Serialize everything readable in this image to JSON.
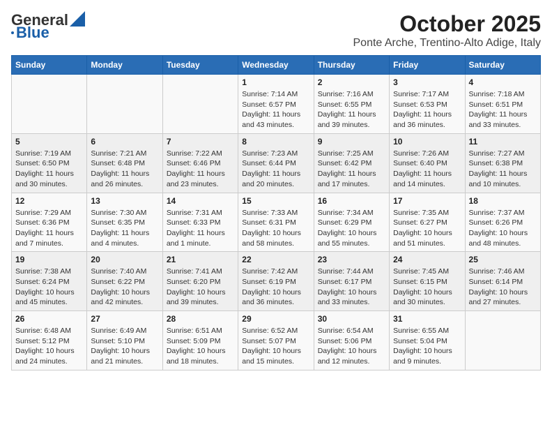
{
  "header": {
    "logo_line1": "General",
    "logo_line2": "Blue",
    "title": "October 2025",
    "subtitle": "Ponte Arche, Trentino-Alto Adige, Italy"
  },
  "weekdays": [
    "Sunday",
    "Monday",
    "Tuesday",
    "Wednesday",
    "Thursday",
    "Friday",
    "Saturday"
  ],
  "weeks": [
    [
      {
        "day": "",
        "info": ""
      },
      {
        "day": "",
        "info": ""
      },
      {
        "day": "",
        "info": ""
      },
      {
        "day": "1",
        "info": "Sunrise: 7:14 AM\nSunset: 6:57 PM\nDaylight: 11 hours and 43 minutes."
      },
      {
        "day": "2",
        "info": "Sunrise: 7:16 AM\nSunset: 6:55 PM\nDaylight: 11 hours and 39 minutes."
      },
      {
        "day": "3",
        "info": "Sunrise: 7:17 AM\nSunset: 6:53 PM\nDaylight: 11 hours and 36 minutes."
      },
      {
        "day": "4",
        "info": "Sunrise: 7:18 AM\nSunset: 6:51 PM\nDaylight: 11 hours and 33 minutes."
      }
    ],
    [
      {
        "day": "5",
        "info": "Sunrise: 7:19 AM\nSunset: 6:50 PM\nDaylight: 11 hours and 30 minutes."
      },
      {
        "day": "6",
        "info": "Sunrise: 7:21 AM\nSunset: 6:48 PM\nDaylight: 11 hours and 26 minutes."
      },
      {
        "day": "7",
        "info": "Sunrise: 7:22 AM\nSunset: 6:46 PM\nDaylight: 11 hours and 23 minutes."
      },
      {
        "day": "8",
        "info": "Sunrise: 7:23 AM\nSunset: 6:44 PM\nDaylight: 11 hours and 20 minutes."
      },
      {
        "day": "9",
        "info": "Sunrise: 7:25 AM\nSunset: 6:42 PM\nDaylight: 11 hours and 17 minutes."
      },
      {
        "day": "10",
        "info": "Sunrise: 7:26 AM\nSunset: 6:40 PM\nDaylight: 11 hours and 14 minutes."
      },
      {
        "day": "11",
        "info": "Sunrise: 7:27 AM\nSunset: 6:38 PM\nDaylight: 11 hours and 10 minutes."
      }
    ],
    [
      {
        "day": "12",
        "info": "Sunrise: 7:29 AM\nSunset: 6:36 PM\nDaylight: 11 hours and 7 minutes."
      },
      {
        "day": "13",
        "info": "Sunrise: 7:30 AM\nSunset: 6:35 PM\nDaylight: 11 hours and 4 minutes."
      },
      {
        "day": "14",
        "info": "Sunrise: 7:31 AM\nSunset: 6:33 PM\nDaylight: 11 hours and 1 minute."
      },
      {
        "day": "15",
        "info": "Sunrise: 7:33 AM\nSunset: 6:31 PM\nDaylight: 10 hours and 58 minutes."
      },
      {
        "day": "16",
        "info": "Sunrise: 7:34 AM\nSunset: 6:29 PM\nDaylight: 10 hours and 55 minutes."
      },
      {
        "day": "17",
        "info": "Sunrise: 7:35 AM\nSunset: 6:27 PM\nDaylight: 10 hours and 51 minutes."
      },
      {
        "day": "18",
        "info": "Sunrise: 7:37 AM\nSunset: 6:26 PM\nDaylight: 10 hours and 48 minutes."
      }
    ],
    [
      {
        "day": "19",
        "info": "Sunrise: 7:38 AM\nSunset: 6:24 PM\nDaylight: 10 hours and 45 minutes."
      },
      {
        "day": "20",
        "info": "Sunrise: 7:40 AM\nSunset: 6:22 PM\nDaylight: 10 hours and 42 minutes."
      },
      {
        "day": "21",
        "info": "Sunrise: 7:41 AM\nSunset: 6:20 PM\nDaylight: 10 hours and 39 minutes."
      },
      {
        "day": "22",
        "info": "Sunrise: 7:42 AM\nSunset: 6:19 PM\nDaylight: 10 hours and 36 minutes."
      },
      {
        "day": "23",
        "info": "Sunrise: 7:44 AM\nSunset: 6:17 PM\nDaylight: 10 hours and 33 minutes."
      },
      {
        "day": "24",
        "info": "Sunrise: 7:45 AM\nSunset: 6:15 PM\nDaylight: 10 hours and 30 minutes."
      },
      {
        "day": "25",
        "info": "Sunrise: 7:46 AM\nSunset: 6:14 PM\nDaylight: 10 hours and 27 minutes."
      }
    ],
    [
      {
        "day": "26",
        "info": "Sunrise: 6:48 AM\nSunset: 5:12 PM\nDaylight: 10 hours and 24 minutes."
      },
      {
        "day": "27",
        "info": "Sunrise: 6:49 AM\nSunset: 5:10 PM\nDaylight: 10 hours and 21 minutes."
      },
      {
        "day": "28",
        "info": "Sunrise: 6:51 AM\nSunset: 5:09 PM\nDaylight: 10 hours and 18 minutes."
      },
      {
        "day": "29",
        "info": "Sunrise: 6:52 AM\nSunset: 5:07 PM\nDaylight: 10 hours and 15 minutes."
      },
      {
        "day": "30",
        "info": "Sunrise: 6:54 AM\nSunset: 5:06 PM\nDaylight: 10 hours and 12 minutes."
      },
      {
        "day": "31",
        "info": "Sunrise: 6:55 AM\nSunset: 5:04 PM\nDaylight: 10 hours and 9 minutes."
      },
      {
        "day": "",
        "info": ""
      }
    ]
  ]
}
